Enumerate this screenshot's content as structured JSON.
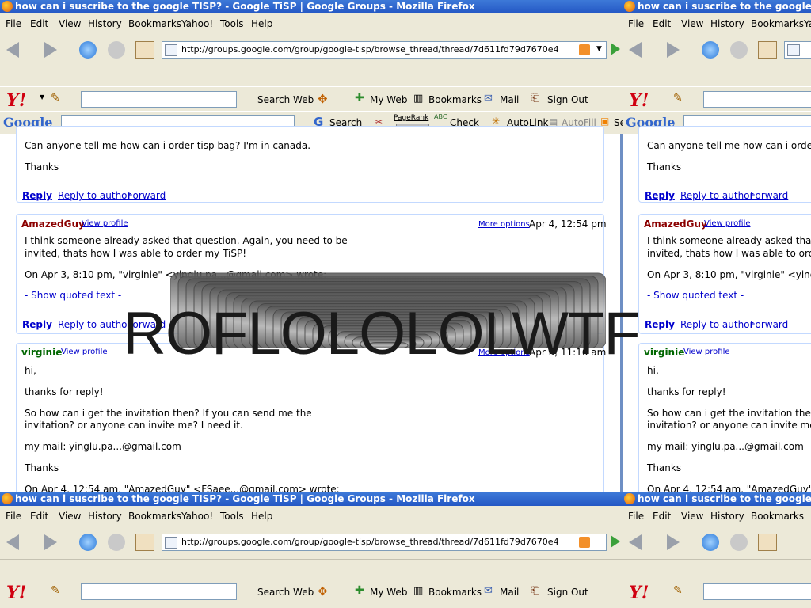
{
  "window": {
    "title": "how can i suscribe to the google TISP? - Google TiSP | Google Groups - Mozilla Firefox",
    "menu": [
      "File",
      "Edit",
      "View",
      "History",
      "Bookmarks",
      "Yahoo!",
      "Tools",
      "Help"
    ],
    "url": "http://groups.google.com/group/google-tisp/browse_thread/thread/7d611fd79d7670e4"
  },
  "yahoo_toolbar": {
    "logo": "Y!",
    "search_web": "Search Web",
    "my_web": "My Web",
    "bookmarks": "Bookmarks",
    "mail": "Mail",
    "sign_out": "Sign Out"
  },
  "google_toolbar": {
    "logo": "Google",
    "search": "Search",
    "pagerank": "PageRank",
    "check": "Check",
    "check_icon": "ABC",
    "autolink": "AutoLink",
    "autofill": "AutoFill",
    "trailing": "Se"
  },
  "posts": {
    "first": {
      "line1": "Can anyone tell me how can i order tisp bag? I'm in canada.",
      "line2": "Thanks"
    },
    "actions": {
      "reply": "Reply",
      "reply_author": "Reply to author",
      "forward": "Forward"
    },
    "second": {
      "author": "AmazedGuy",
      "view_profile": "View profile",
      "more_options": "More options",
      "date": "Apr 4, 12:54 pm",
      "line1": "I think someone already asked that question. Again, you need to be",
      "line2": "invited, thats how I was able to order my TiSP!",
      "quote": "On Apr 3, 8:10 pm, \"virginie\" <yinglu.pa...@gmail.com> wrote:",
      "show_quoted": "- Show quoted text -"
    },
    "third": {
      "author": "virginie",
      "view_profile": "View profile",
      "more_options": "More options",
      "date": "Apr 5, 11:16 am",
      "line1": "hi,",
      "line2": "thanks for reply!",
      "line3": "So how can i get the invitation then? If you can send me the",
      "line4": "invitation? or anyone can invite me? I need it.",
      "line5": "my mail: yinglu.pa...@gmail.com",
      "line6": "Thanks",
      "quote": "On Apr 4, 12:54 am, \"AmazedGuy\" <FSaee...@gmail.com> wrote:"
    }
  },
  "overlay": {
    "text": "ROFLOLOLOLWTF"
  },
  "colors": {
    "title_blue": "#2457c4",
    "link": "#0000cc",
    "author_red": "#8b0000",
    "author_green": "#006600"
  }
}
